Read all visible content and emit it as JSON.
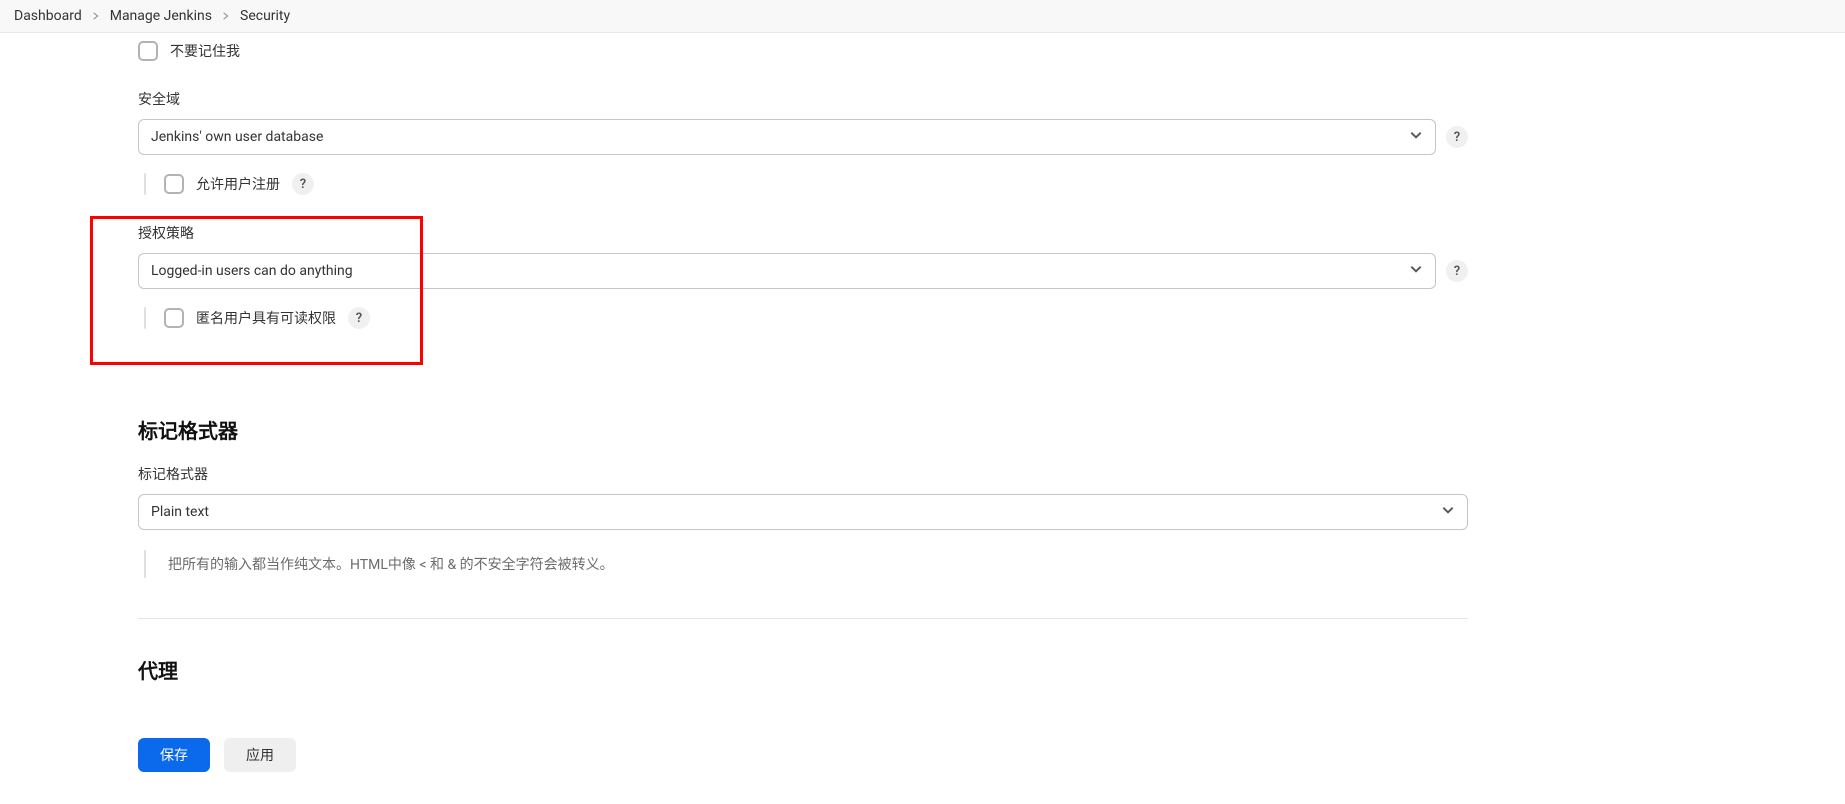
{
  "breadcrumb": {
    "items": [
      "Dashboard",
      "Manage Jenkins",
      "Security"
    ]
  },
  "remember": {
    "label": "不要记住我"
  },
  "securityRealm": {
    "label": "安全域",
    "selected": "Jenkins' own user database",
    "allowSignup": "允许用户注册"
  },
  "authorization": {
    "label": "授权策略",
    "selected": "Logged-in users can do anything",
    "anonRead": "匿名用户具有可读权限"
  },
  "markup": {
    "heading": "标记格式器",
    "label": "标记格式器",
    "selected": "Plain text",
    "help": "把所有的输入都当作纯文本。HTML中像 < 和 & 的不安全字符会被转义。"
  },
  "proxyHeading": "代理",
  "buttons": {
    "save": "保存",
    "apply": "应用"
  },
  "helpGlyph": "?"
}
